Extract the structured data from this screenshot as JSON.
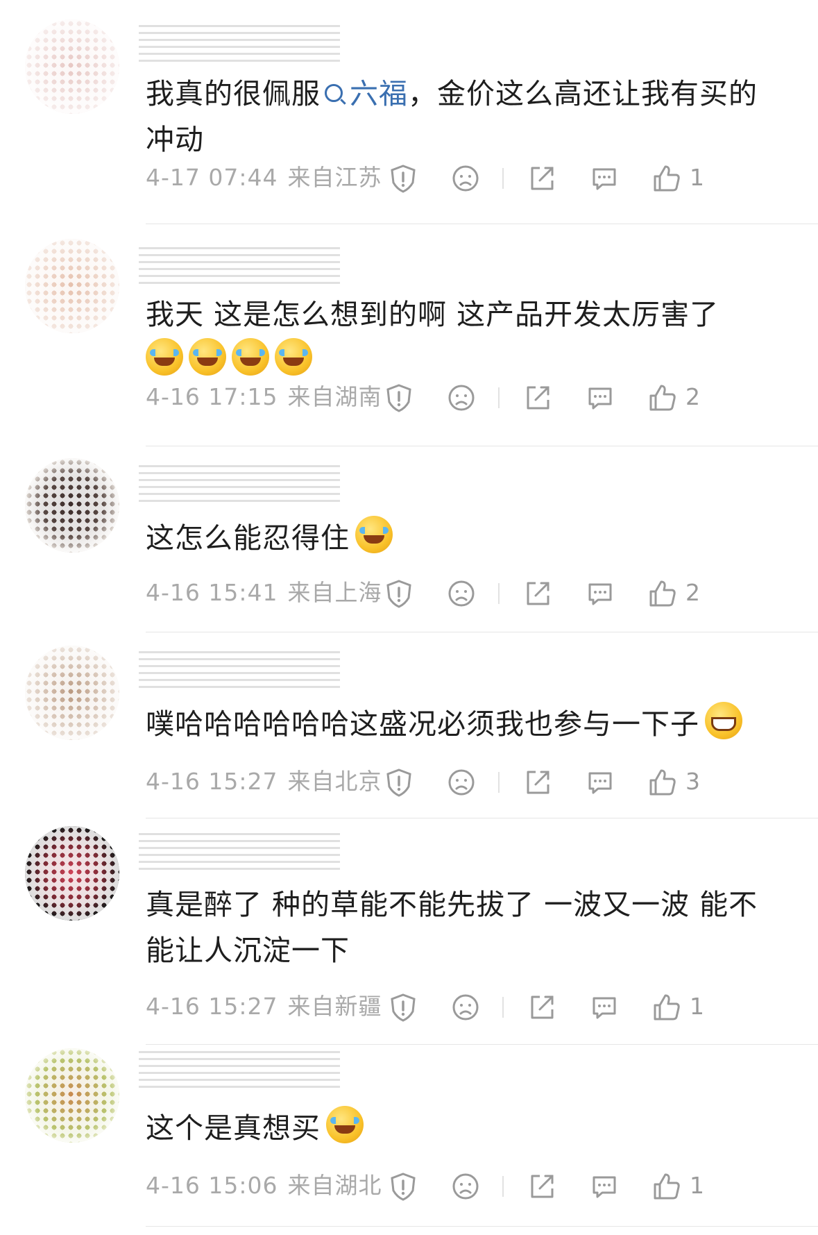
{
  "comments": [
    {
      "text_parts": [
        "我真的很佩服",
        "六福",
        "，金价这么高还让我有买的冲动"
      ],
      "time": "4-17 07:44",
      "location": "来自江苏",
      "likes": "1",
      "avatar_colors": [
        "#f0d9d6",
        "#c79894"
      ]
    },
    {
      "text": "我天 这是怎么想到的啊 这产品开发太厉害了",
      "emoji_count": 4,
      "time": "4-16 17:15",
      "location": "来自湖南",
      "likes": "2",
      "avatar_colors": [
        "#f3e3d8",
        "#cfa48e"
      ]
    },
    {
      "text": "这怎么能忍得住",
      "time": "4-16 15:41",
      "location": "来自上海",
      "likes": "2",
      "avatar_colors": [
        "#2b2221",
        "#d9d1ca"
      ]
    },
    {
      "text": "噗哈哈哈哈哈哈这盛况必须我也参与一下子",
      "time": "4-16 15:27",
      "location": "来自北京",
      "likes": "3",
      "avatar_colors": [
        "#c8a88f",
        "#e9e6e3"
      ]
    },
    {
      "text": "真是醉了 种的草能不能先拔了 一波又一波 能不能让人沉淀一下",
      "time": "4-16 15:27",
      "location": "来自新疆",
      "likes": "1",
      "avatar_colors": [
        "#c83d52",
        "#1c1c1c"
      ]
    },
    {
      "text": "这个是真想买",
      "time": "4-16 15:06",
      "location": "来自湖北",
      "likes": "1",
      "avatar_colors": [
        "#b7c27a",
        "#d89a6c"
      ]
    }
  ],
  "colors": {
    "link": "#3a6fb0",
    "meta_text": "#a9a9a9",
    "divider": "#e6e6e6"
  },
  "icons": [
    "report-icon",
    "dislike-icon",
    "share-icon",
    "reply-icon",
    "like-icon"
  ]
}
